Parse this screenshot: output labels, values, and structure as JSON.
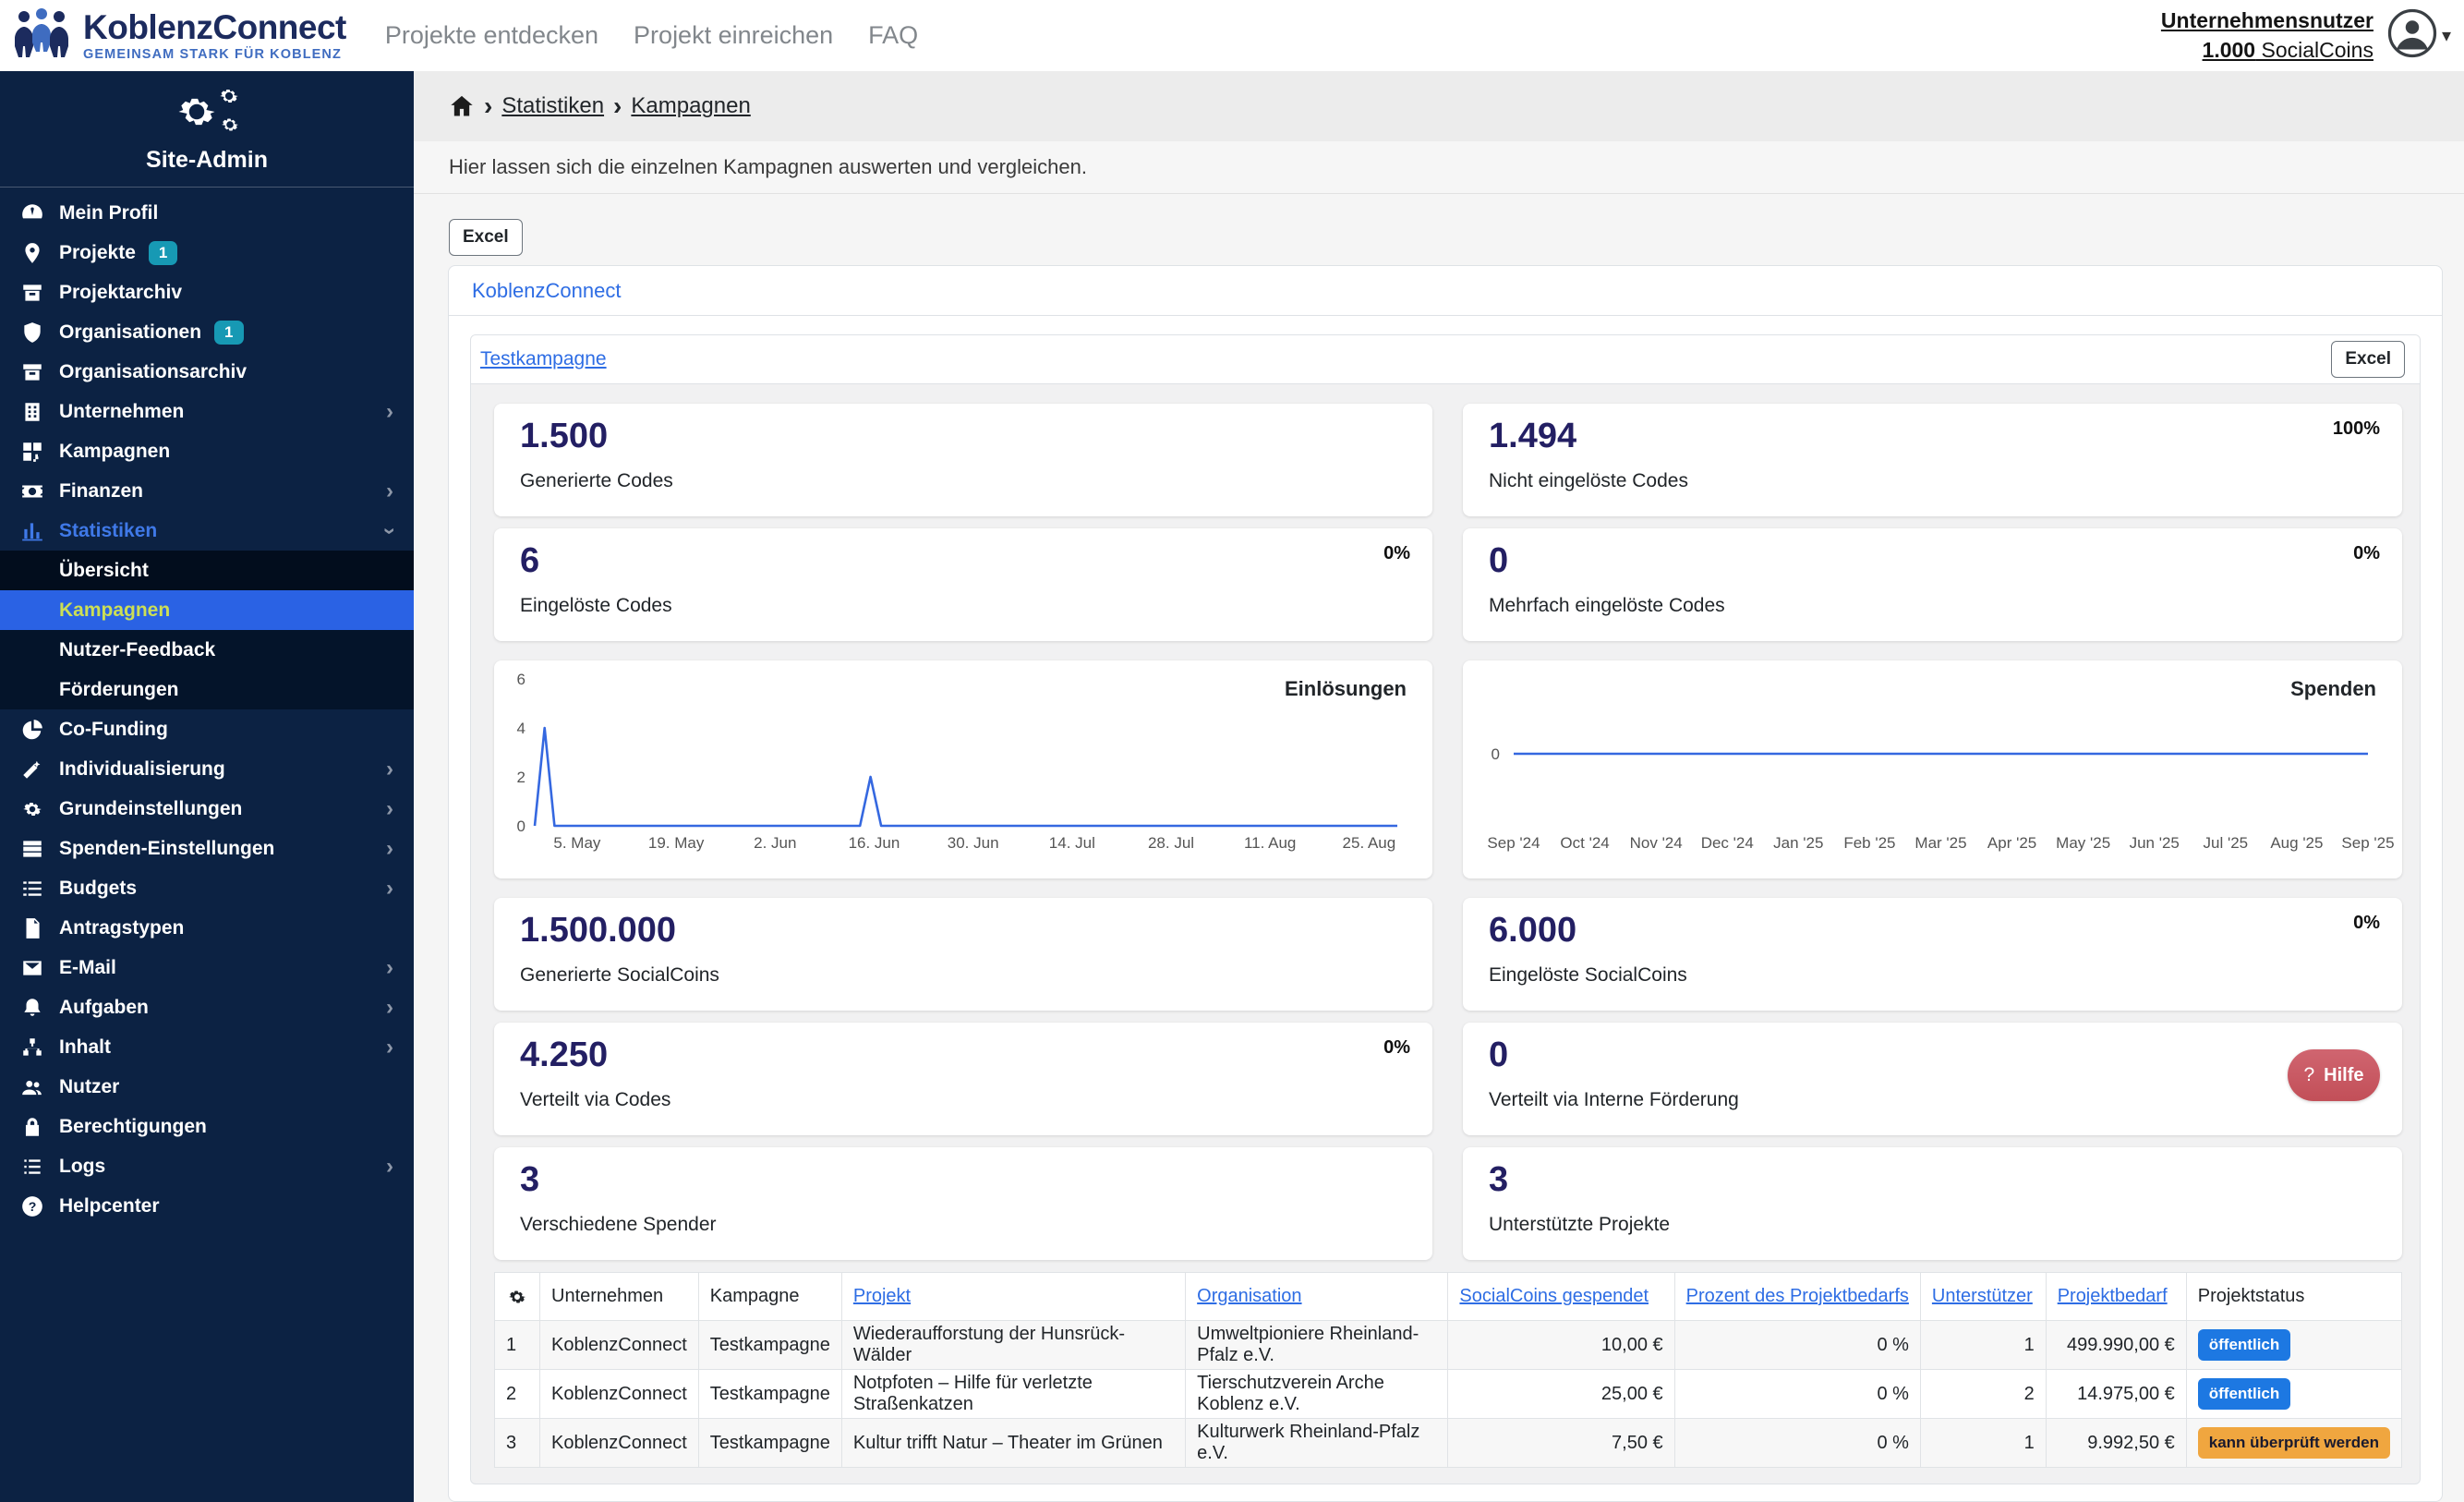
{
  "topbar": {
    "brand_name": "KoblenzConnect",
    "brand_tagline": "GEMEINSAM STARK FÜR KOBLENZ",
    "nav": [
      {
        "label": "Projekte entdecken"
      },
      {
        "label": "Projekt einreichen"
      },
      {
        "label": "FAQ"
      }
    ],
    "user_role": "Unternehmensnutzer",
    "coins_amount": "1.000",
    "coins_label": "SocialCoins"
  },
  "sidebar": {
    "title": "Site-Admin",
    "items": [
      {
        "label": "Mein Profil",
        "icon": "gauge-icon"
      },
      {
        "label": "Projekte",
        "icon": "map-pin-icon",
        "badge": "1"
      },
      {
        "label": "Projektarchiv",
        "icon": "archive-icon"
      },
      {
        "label": "Organisationen",
        "icon": "shield-icon",
        "badge": "1"
      },
      {
        "label": "Organisationsarchiv",
        "icon": "archive-icon"
      },
      {
        "label": "Unternehmen",
        "icon": "building-icon",
        "chevron": "right"
      },
      {
        "label": "Kampagnen",
        "icon": "qr-icon"
      },
      {
        "label": "Finanzen",
        "icon": "money-icon",
        "chevron": "right"
      },
      {
        "label": "Statistiken",
        "icon": "chart-bar-icon",
        "chevron": "down",
        "active_parent": true,
        "submenu": [
          {
            "label": "Übersicht"
          },
          {
            "label": "Kampagnen",
            "active": true
          },
          {
            "label": "Nutzer-Feedback"
          },
          {
            "label": "Förderungen"
          }
        ]
      },
      {
        "label": "Co-Funding",
        "icon": "pie-icon"
      },
      {
        "label": "Individualisierung",
        "icon": "wand-icon",
        "chevron": "right"
      },
      {
        "label": "Grundeinstellungen",
        "icon": "gears-icon",
        "chevron": "right"
      },
      {
        "label": "Spenden-Einstellungen",
        "icon": "rows-icon",
        "chevron": "right"
      },
      {
        "label": "Budgets",
        "icon": "list-check-icon",
        "chevron": "right"
      },
      {
        "label": "Antragstypen",
        "icon": "document-icon"
      },
      {
        "label": "E-Mail",
        "icon": "envelope-icon",
        "chevron": "right"
      },
      {
        "label": "Aufgaben",
        "icon": "bell-icon",
        "chevron": "right"
      },
      {
        "label": "Inhalt",
        "icon": "sitemap-icon",
        "chevron": "right"
      },
      {
        "label": "Nutzer",
        "icon": "users-icon"
      },
      {
        "label": "Berechtigungen",
        "icon": "lock-icon"
      },
      {
        "label": "Logs",
        "icon": "list-icon",
        "chevron": "right"
      },
      {
        "label": "Helpcenter",
        "icon": "question-circle-icon"
      }
    ]
  },
  "breadcrumb": {
    "items": [
      "Statistiken",
      "Kampagnen"
    ]
  },
  "page": {
    "description": "Hier lassen sich die einzelnen Kampagnen auswerten und vergleichen.",
    "excel_label": "Excel"
  },
  "company_card": {
    "title": "KoblenzConnect"
  },
  "campaign_card": {
    "title": "Testkampagne",
    "excel_label": "Excel"
  },
  "help_button": {
    "icon": "?",
    "label": "Hilfe"
  },
  "stats": [
    {
      "value": "1.500",
      "label": "Generierte Codes"
    },
    {
      "value": "1.494",
      "label": "Nicht eingelöste Codes",
      "percent": "100%"
    },
    {
      "value": "6",
      "label": "Eingelöste Codes",
      "percent": "0%"
    },
    {
      "value": "0",
      "label": "Mehrfach eingelöste Codes",
      "percent": "0%"
    },
    {
      "value": "1.500.000",
      "label": "Generierte SocialCoins"
    },
    {
      "value": "6.000",
      "label": "Eingelöste SocialCoins",
      "percent": "0%"
    },
    {
      "value": "4.250",
      "label": "Verteilt via Codes",
      "percent": "0%"
    },
    {
      "value": "0",
      "label": "Verteilt via Interne Förderung",
      "help": true
    },
    {
      "value": "3",
      "label": "Verschiedene Spender"
    },
    {
      "value": "3",
      "label": "Unterstützte Projekte"
    }
  ],
  "chart_data": [
    {
      "type": "line",
      "title": "Einlösungen",
      "line_color": "#3568e0",
      "x_domain": [
        0,
        122
      ],
      "y_domain": [
        0,
        6.6
      ],
      "y_ticks": [
        0,
        2,
        4,
        6
      ],
      "x_ticks": [
        {
          "pos": 6,
          "label": "5. May"
        },
        {
          "pos": 20,
          "label": "19. May"
        },
        {
          "pos": 34,
          "label": "2. Jun"
        },
        {
          "pos": 48,
          "label": "16. Jun"
        },
        {
          "pos": 62,
          "label": "30. Jun"
        },
        {
          "pos": 76,
          "label": "14. Jul"
        },
        {
          "pos": 90,
          "label": "28. Jul"
        },
        {
          "pos": 104,
          "label": "11. Aug"
        },
        {
          "pos": 118,
          "label": "25. Aug"
        }
      ],
      "points": [
        {
          "x": 0,
          "y": 0
        },
        {
          "x": 1.4,
          "y": 4
        },
        {
          "x": 2.8,
          "y": 0
        },
        {
          "x": 46,
          "y": 0
        },
        {
          "x": 47.5,
          "y": 2
        },
        {
          "x": 49,
          "y": 0
        },
        {
          "x": 122,
          "y": 0
        }
      ]
    },
    {
      "type": "line",
      "title": "Spenden",
      "line_color": "#3568e0",
      "x_domain": [
        0,
        12
      ],
      "y_domain": [
        -1,
        1
      ],
      "y_ticks": [
        0
      ],
      "x_ticks": [
        {
          "pos": 0,
          "label": "Sep '24"
        },
        {
          "pos": 1,
          "label": "Oct '24"
        },
        {
          "pos": 2,
          "label": "Nov '24"
        },
        {
          "pos": 3,
          "label": "Dec '24"
        },
        {
          "pos": 4,
          "label": "Jan '25"
        },
        {
          "pos": 5,
          "label": "Feb '25"
        },
        {
          "pos": 6,
          "label": "Mar '25"
        },
        {
          "pos": 7,
          "label": "Apr '25"
        },
        {
          "pos": 8,
          "label": "May '25"
        },
        {
          "pos": 9,
          "label": "Jun '25"
        },
        {
          "pos": 10,
          "label": "Jul '25"
        },
        {
          "pos": 11,
          "label": "Aug '25"
        },
        {
          "pos": 12,
          "label": "Sep '25"
        }
      ],
      "points": [
        {
          "x": 0,
          "y": 0
        },
        {
          "x": 12,
          "y": 0
        }
      ]
    }
  ],
  "table": {
    "headers": [
      {
        "label": "",
        "icon": "gear-icon"
      },
      {
        "label": "Unternehmen"
      },
      {
        "label": "Kampagne"
      },
      {
        "label": "Projekt",
        "link": true
      },
      {
        "label": "Organisation",
        "link": true
      },
      {
        "label": "SocialCoins gespendet",
        "link": true,
        "numeric": true
      },
      {
        "label": "Prozent des Projektbedarfs",
        "link": true,
        "numeric": true
      },
      {
        "label": "Unterstützer",
        "link": true,
        "numeric": true
      },
      {
        "label": "Projektbedarf",
        "link": true,
        "numeric": true
      },
      {
        "label": "Projektstatus"
      }
    ],
    "rows": [
      {
        "nr": "1",
        "unternehmen": "KoblenzConnect",
        "kampagne": "Testkampagne",
        "projekt": "Wiederaufforstung der Hunsrück-Wälder",
        "organisation": "Umweltpioniere Rheinland-Pfalz e.V.",
        "gespendet": "10,00 €",
        "prozent": "0 %",
        "unterstuetzer": "1",
        "projektbedarf": "499.990,00 €",
        "status": "öffentlich",
        "status_type": "public"
      },
      {
        "nr": "2",
        "unternehmen": "KoblenzConnect",
        "kampagne": "Testkampagne",
        "projekt": "Notpfoten – Hilfe für verletzte Straßenkatzen",
        "organisation": "Tierschutzverein Arche Koblenz e.V.",
        "gespendet": "25,00 €",
        "prozent": "0 %",
        "unterstuetzer": "2",
        "projektbedarf": "14.975,00 €",
        "status": "öffentlich",
        "status_type": "public"
      },
      {
        "nr": "3",
        "unternehmen": "KoblenzConnect",
        "kampagne": "Testkampagne",
        "projekt": "Kultur trifft Natur – Theater im Grünen",
        "organisation": "Kulturwerk Rheinland-Pfalz e.V.",
        "gespendet": "7,50 €",
        "prozent": "0 %",
        "unterstuetzer": "1",
        "projektbedarf": "9.992,50 €",
        "status": "kann überprüft werden",
        "status_type": "review"
      }
    ]
  },
  "colors": {
    "sidebar_bg": "#0c2243",
    "sidebar_active_bg": "#2a62e4",
    "sidebar_active_text": "#ccdf55",
    "accent_link": "#2e6de4",
    "stat_value": "#231f63",
    "badge_teal": "#1799b4",
    "status_public": "#1d78e2",
    "status_review": "#f0a63f",
    "help_red": "#c8545e",
    "chart_line": "#3568e0"
  }
}
